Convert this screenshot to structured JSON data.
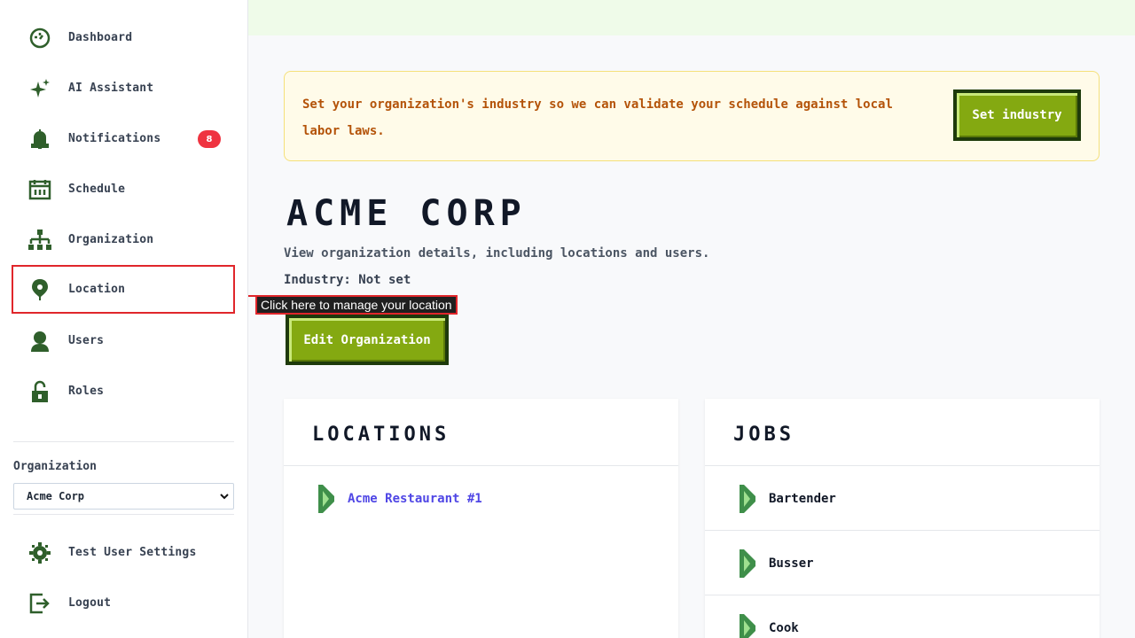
{
  "sidebar": {
    "items": [
      {
        "label": "Dashboard",
        "icon": "dashboard-icon"
      },
      {
        "label": "AI Assistant",
        "icon": "sparkle-icon"
      },
      {
        "label": "Notifications",
        "icon": "bell-icon",
        "badge": "8"
      },
      {
        "label": "Schedule",
        "icon": "calendar-icon"
      },
      {
        "label": "Organization",
        "icon": "org-chart-icon"
      },
      {
        "label": "Location",
        "icon": "map-pin-icon"
      },
      {
        "label": "Users",
        "icon": "user-icon"
      },
      {
        "label": "Roles",
        "icon": "unlock-icon"
      }
    ],
    "organization_label": "Organization",
    "organization_selected": "Acme Corp",
    "footer_items": [
      {
        "label": "Test User Settings",
        "icon": "gear-icon"
      },
      {
        "label": "Logout",
        "icon": "logout-icon"
      }
    ]
  },
  "alert": {
    "message": "Set your organization's industry so we can validate your schedule against local labor laws.",
    "button_label": "Set industry"
  },
  "page": {
    "title": "ACME CORP",
    "description": "View organization details, including locations and users.",
    "industry": "Industry: Not set",
    "edit_button": "Edit Organization"
  },
  "tooltip": {
    "text": "Click here to manage your location"
  },
  "locations_card": {
    "title": "LOCATIONS",
    "items": [
      "Acme Restaurant #1"
    ]
  },
  "jobs_card": {
    "title": "JOBS",
    "items": [
      "Bartender",
      "Busser",
      "Cook"
    ]
  },
  "colors": {
    "icon_green": "#2f5f2b",
    "button_green": "#84a911",
    "button_border": "#1e3a0b",
    "alert_text": "#b45309",
    "link": "#4f46e5",
    "highlight_red": "#e0262b"
  }
}
